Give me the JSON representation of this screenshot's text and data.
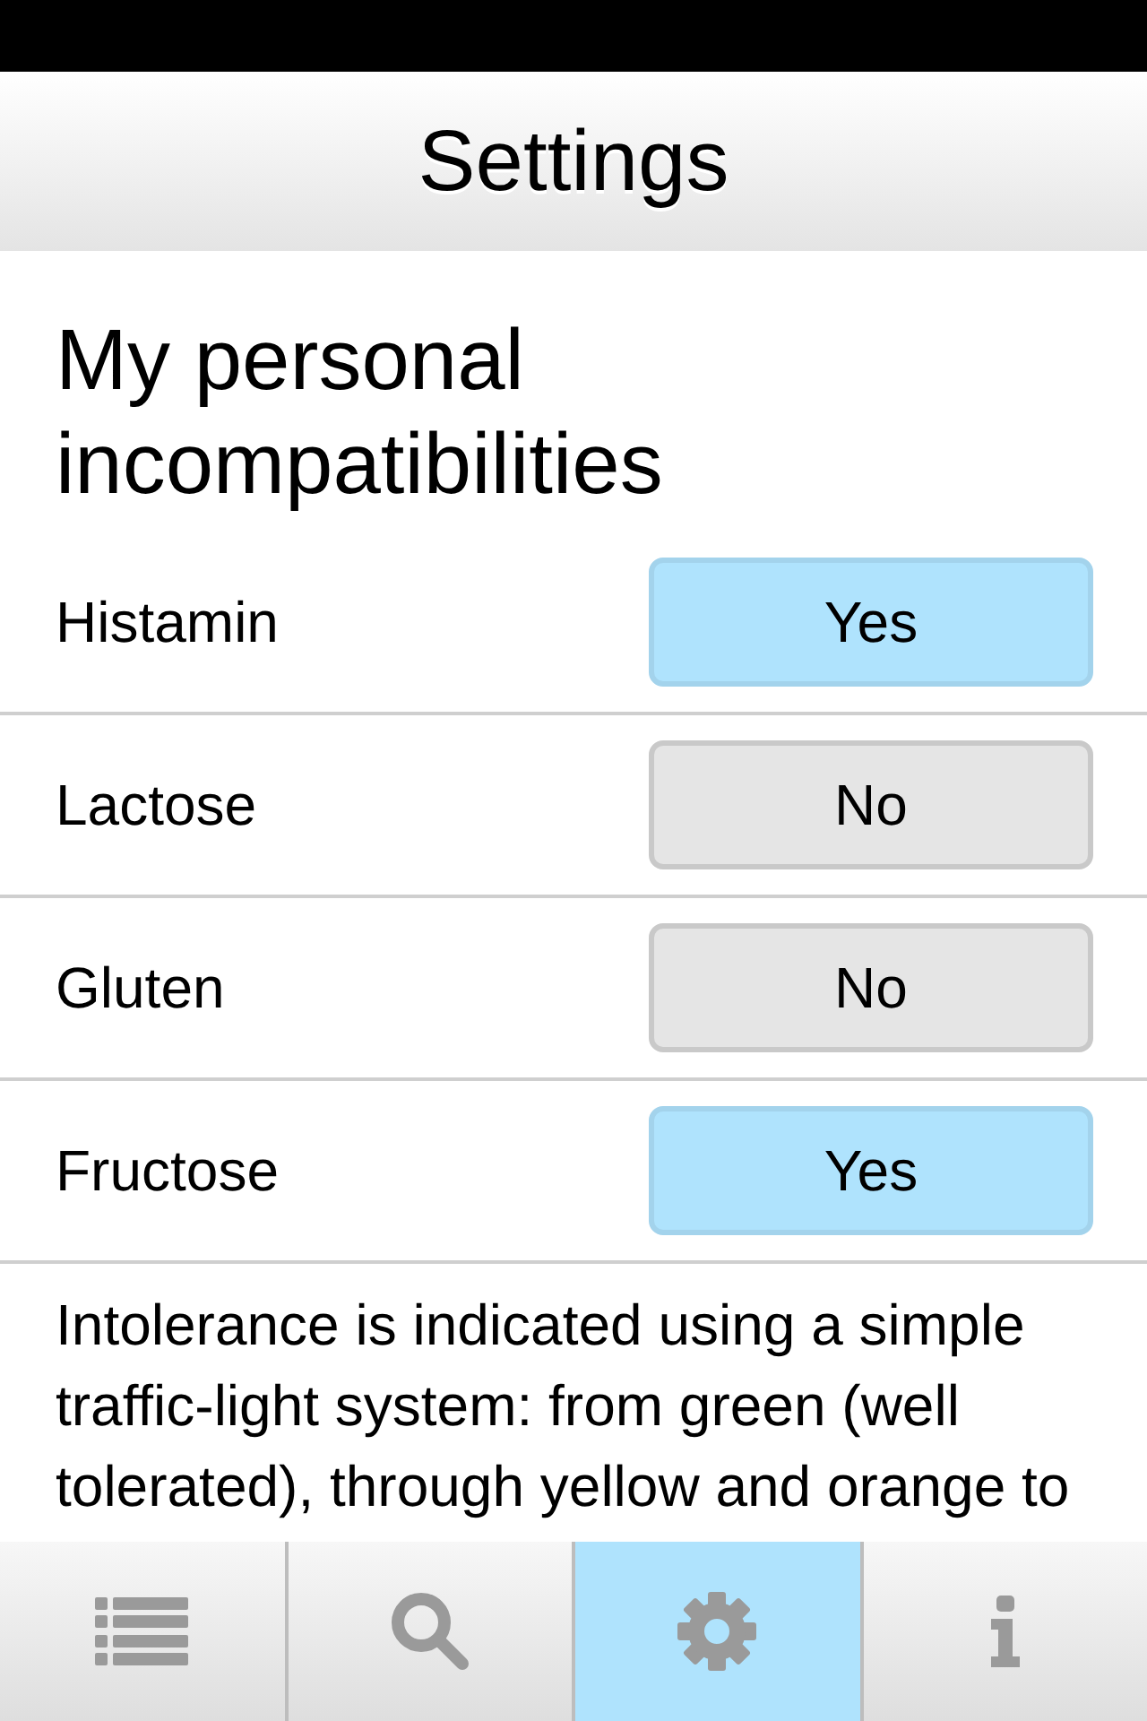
{
  "header": {
    "title": "Settings"
  },
  "section": {
    "heading": "My personal incompatibilities"
  },
  "items": [
    {
      "label": "Histamin",
      "button": "Yes",
      "on": true
    },
    {
      "label": "Lactose",
      "button": "No",
      "on": false
    },
    {
      "label": "Gluten",
      "button": "No",
      "on": false
    },
    {
      "label": "Fructose",
      "button": "Yes",
      "on": true
    }
  ],
  "note": "Intolerance is indicated using a simple traffic-light system: from green (well tolerated), through yellow and orange to",
  "tab_bar": {
    "tabs": [
      {
        "kind": "list",
        "selected": false
      },
      {
        "kind": "search",
        "selected": false
      },
      {
        "kind": "settings",
        "selected": true
      },
      {
        "kind": "info",
        "selected": false
      }
    ]
  }
}
